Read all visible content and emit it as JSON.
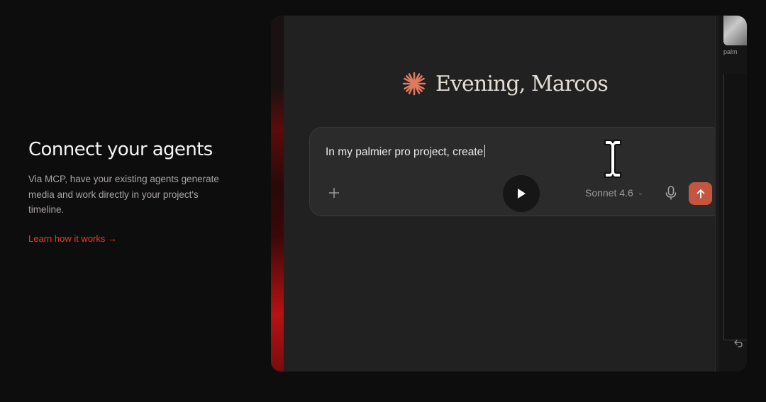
{
  "hero": {
    "heading": "Connect your agents",
    "description": "Via MCP, have your existing agents generate media and work directly in your project's timeline.",
    "link_label": "Learn how it works →"
  },
  "app": {
    "greeting": "Evening, Marcos",
    "prompt_value": "In my palmier pro project, create",
    "model_label": "Sonnet 4.6",
    "sidebar_thumb_label": "palm",
    "icons": {
      "brand": "spark-icon",
      "add": "plus-icon",
      "play": "play-icon",
      "mic": "microphone-icon",
      "send": "arrow-up-icon",
      "undo": "undo-icon",
      "cursor": "text-cursor-icon"
    },
    "colors": {
      "accent": "#c4553f",
      "link": "#e0412f",
      "spark": "#e07a5f"
    }
  }
}
